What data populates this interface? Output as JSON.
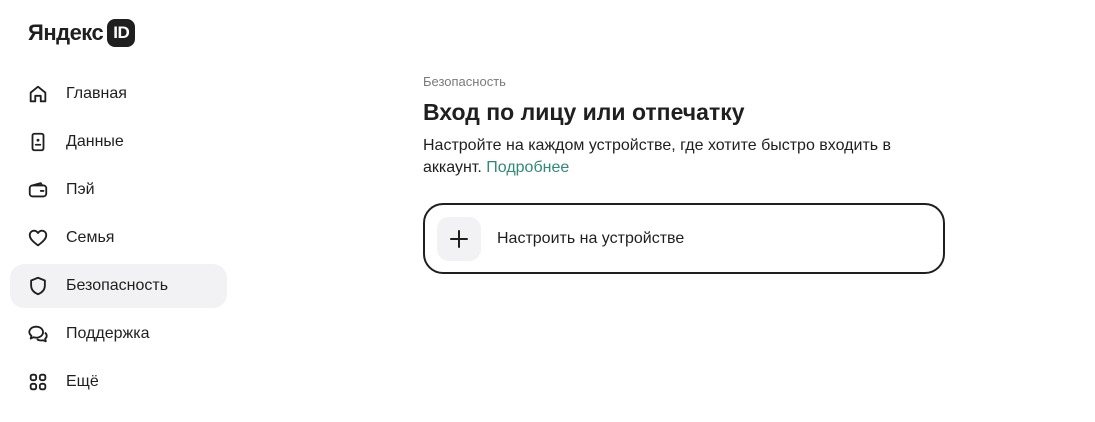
{
  "logo": {
    "text": "Яндекс",
    "badge": "ID"
  },
  "sidebar": {
    "items": [
      {
        "label": "Главная",
        "icon": "home-icon",
        "active": false
      },
      {
        "label": "Данные",
        "icon": "id-card-icon",
        "active": false
      },
      {
        "label": "Пэй",
        "icon": "wallet-icon",
        "active": false
      },
      {
        "label": "Семья",
        "icon": "heart-icon",
        "active": false
      },
      {
        "label": "Безопасность",
        "icon": "shield-icon",
        "active": true
      },
      {
        "label": "Поддержка",
        "icon": "chat-bubbles-icon",
        "active": false
      },
      {
        "label": "Ещё",
        "icon": "grid-icon",
        "active": false
      }
    ]
  },
  "main": {
    "caption": "Безопасность",
    "title": "Вход по лицу или отпечатку",
    "description": "Настройте на каждом устройстве, где хотите быстро входить в аккаунт.",
    "link_label": "Подробнее",
    "setup_button": {
      "label": "Настроить на устройстве",
      "icon": "plus-icon"
    }
  },
  "colors": {
    "accent_link": "#2f8a7a",
    "active_bg": "#f2f2f4",
    "text": "#1f1f1f",
    "muted": "#7a7a7a"
  }
}
